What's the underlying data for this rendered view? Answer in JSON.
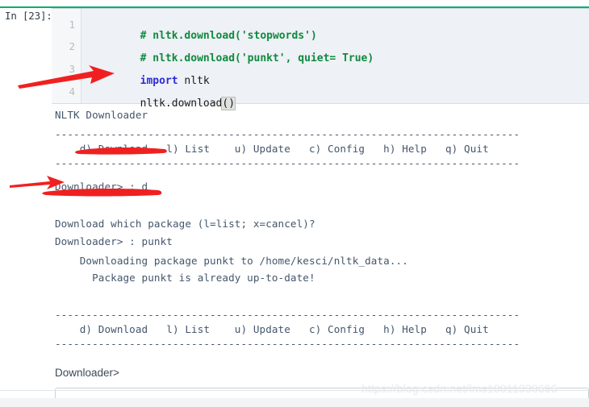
{
  "notebook": {
    "cell_prompt": "In [23]:",
    "accent_color": "#00b06b",
    "editor_bg": "#eef1f6",
    "line_numbers": [
      "1",
      "2",
      "3",
      "4"
    ],
    "code_lines": [
      {
        "n": "1",
        "segments": [
          {
            "text": "# nltk.download('stopwords')",
            "type": "comment"
          }
        ]
      },
      {
        "n": "2",
        "segments": [
          {
            "text": "# nltk.download('punkt', quiet= True)",
            "type": "comment"
          }
        ]
      },
      {
        "n": "3",
        "segments": [
          {
            "text": "import",
            "type": "keyword"
          },
          {
            "text": " nltk",
            "type": "plain"
          }
        ]
      },
      {
        "n": "4",
        "segments": [
          {
            "text": "nltk.download",
            "type": "plain"
          },
          {
            "text": "()",
            "type": "bracket-match"
          }
        ]
      }
    ],
    "raw_code": "# nltk.download('stopwords')\n# nltk.download('punkt', quiet= True)\nimport nltk\nnltk.download()"
  },
  "output": {
    "lines": [
      "NLTK Downloader",
      "---------------------------------------------------------------------------",
      "    d) Download   l) List    u) Update   c) Config   h) Help   q) Quit",
      "---------------------------------------------------------------------------",
      "Downloader> : d",
      "Download which package (l=list; x=cancel)?",
      "Downloader> : punkt",
      "    Downloading package punkt to /home/kesci/nltk_data...",
      "      Package punkt is already up-to-date!",
      "---------------------------------------------------------------------------",
      "    d) Download   l) List    u) Update   c) Config   h) Help   q) Quit",
      "---------------------------------------------------------------------------"
    ],
    "title": "NLTK Downloader",
    "separator": "---------------------------------------------------------------------------",
    "menu": {
      "raw": "    d) Download   l) List    u) Update   c) Config   h) Help   q) Quit",
      "items": [
        {
          "key": "d",
          "label": "Download"
        },
        {
          "key": "l",
          "label": "List"
        },
        {
          "key": "u",
          "label": "Update"
        },
        {
          "key": "c",
          "label": "Config"
        },
        {
          "key": "h",
          "label": "Help"
        },
        {
          "key": "q",
          "label": "Quit"
        }
      ]
    },
    "prompt_1": "Downloader> : d",
    "question": "Download which package (l=list; x=cancel)?",
    "prompt_2": "Downloader> : punkt",
    "downloading": "    Downloading package punkt to /home/kesci/nltk_data...",
    "uptodate": "      Package punkt is already up-to-date!"
  },
  "input_prompt": {
    "label": "Downloader>",
    "value": "",
    "placeholder": ""
  },
  "annotations": {
    "color": "#f02020",
    "arrow_1_target": "nltk.download() line 4",
    "arrow_2_target": "Downloader> : d",
    "underline_1_target": "d) Download",
    "underline_2_target": "Downloader> : d"
  },
  "watermark": {
    "text": "https://blog.csdn.net/lms18811338696"
  }
}
